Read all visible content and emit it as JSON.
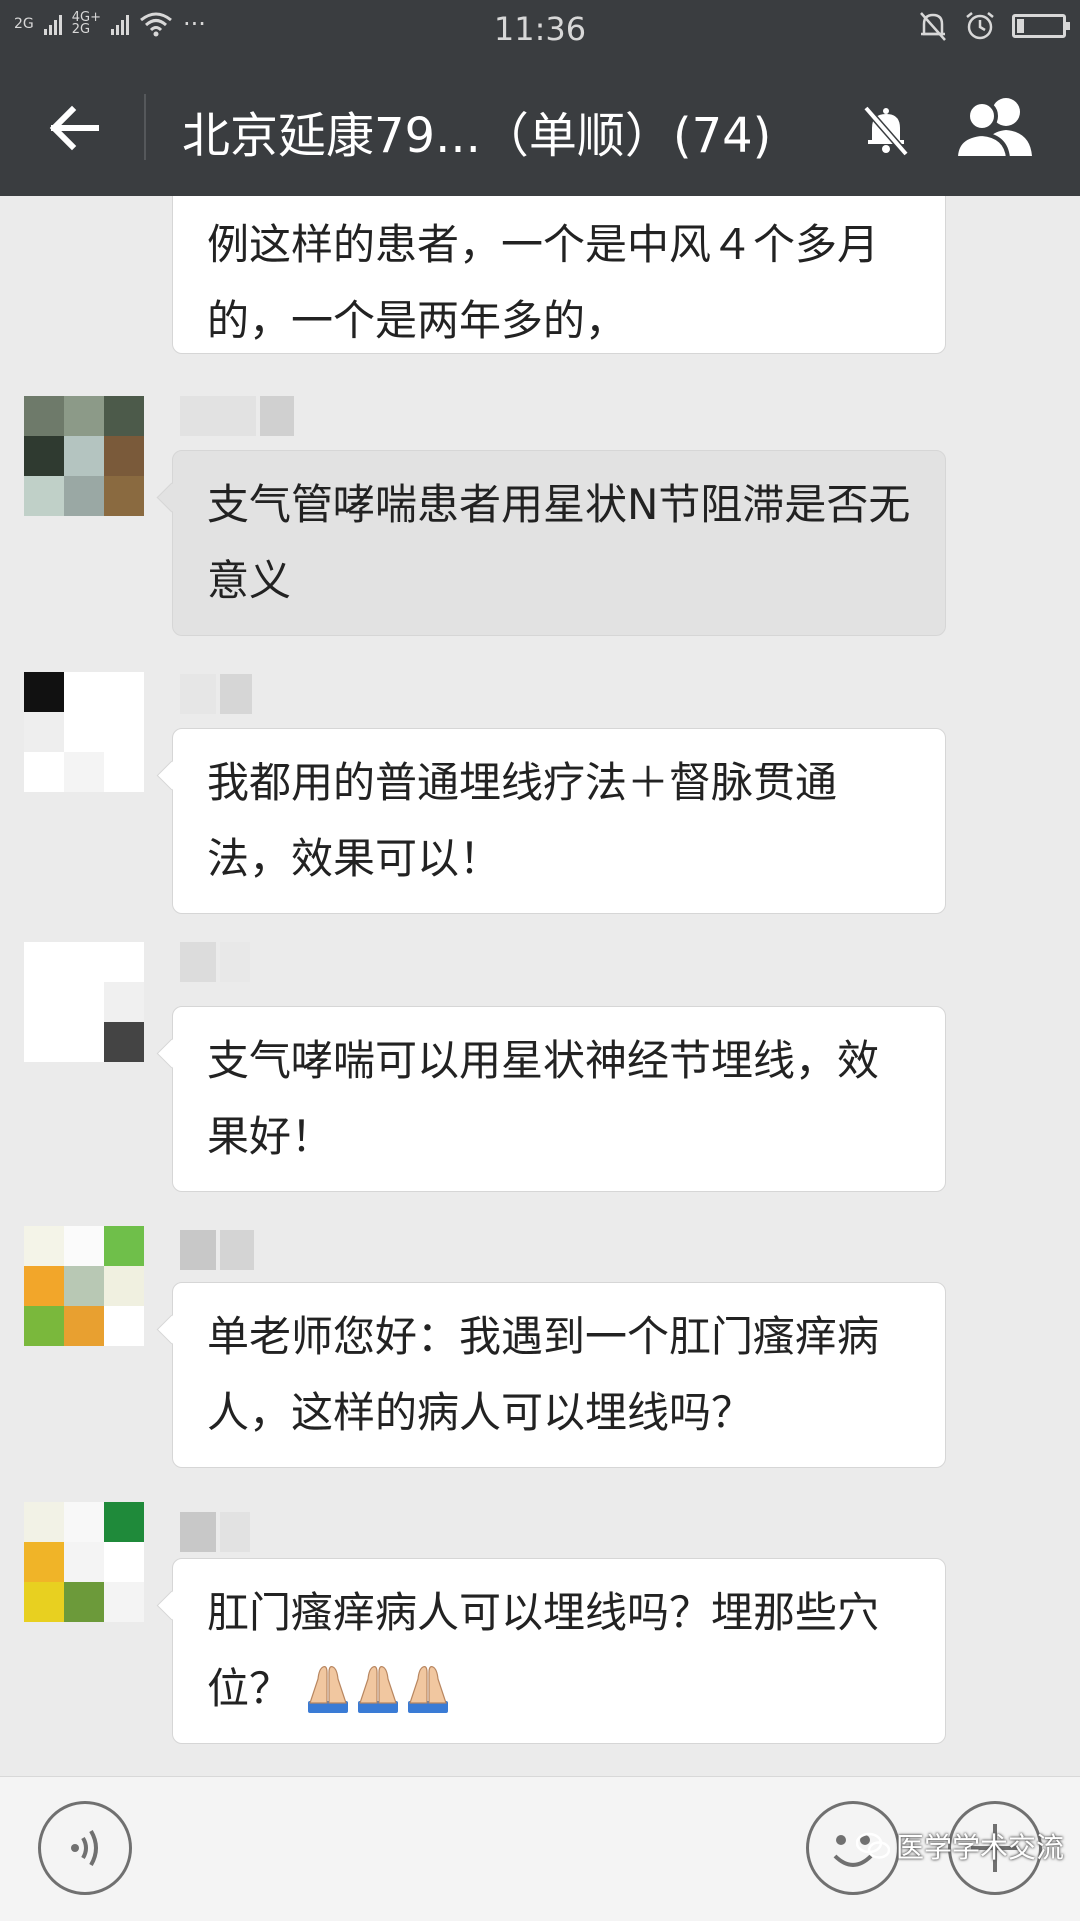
{
  "status_bar": {
    "network_label_1": "2G",
    "network_label_2": "4G+\n2G",
    "more_dots": "···",
    "time": "11:36",
    "icons": [
      "signal-icon",
      "wifi-icon",
      "alarm-muted-icon",
      "alarm-clock-icon",
      "battery-icon"
    ],
    "battery_level": 0.15
  },
  "header": {
    "back_icon": "arrow-left-icon",
    "title": "北京延康79...（单顺）(74)",
    "mute_icon": "bell-muted-icon",
    "members_icon": "group-members-icon"
  },
  "messages": [
    {
      "id": 0,
      "text": "例这样的患者，一个是中风４个多月的，一个是两年多的，",
      "continued": true
    },
    {
      "id": 1,
      "text": "支气管哮喘患者用星状N节阻滞是否无意义",
      "highlighted": true
    },
    {
      "id": 2,
      "text": "我都用的普通埋线疗法＋督脉贯通法，效果可以！"
    },
    {
      "id": 3,
      "text": "支气哮喘可以用星状神经节埋线，效果好！"
    },
    {
      "id": 4,
      "text": "单老师您好：我遇到一个肛门瘙痒病人，这样的病人可以埋线吗？"
    },
    {
      "id": 5,
      "text": "肛门瘙痒病人可以埋线吗？埋那些穴位？",
      "emoji": [
        "folded-hands-icon",
        "folded-hands-icon",
        "folded-hands-icon"
      ]
    }
  ],
  "input_bar": {
    "voice_icon": "voice-input-icon",
    "emoji_icon": "emoji-face-icon",
    "plus_icon": "plus-icon"
  },
  "watermark": {
    "text": "医学学术交流",
    "icon": "wechat-logo-icon"
  },
  "colors": {
    "header_bg": "#3a3d40",
    "chat_bg": "#ebebeb",
    "bubble_bg": "#ffffff",
    "bubble_highlight_bg": "#e2e2e2",
    "text": "#222222"
  }
}
